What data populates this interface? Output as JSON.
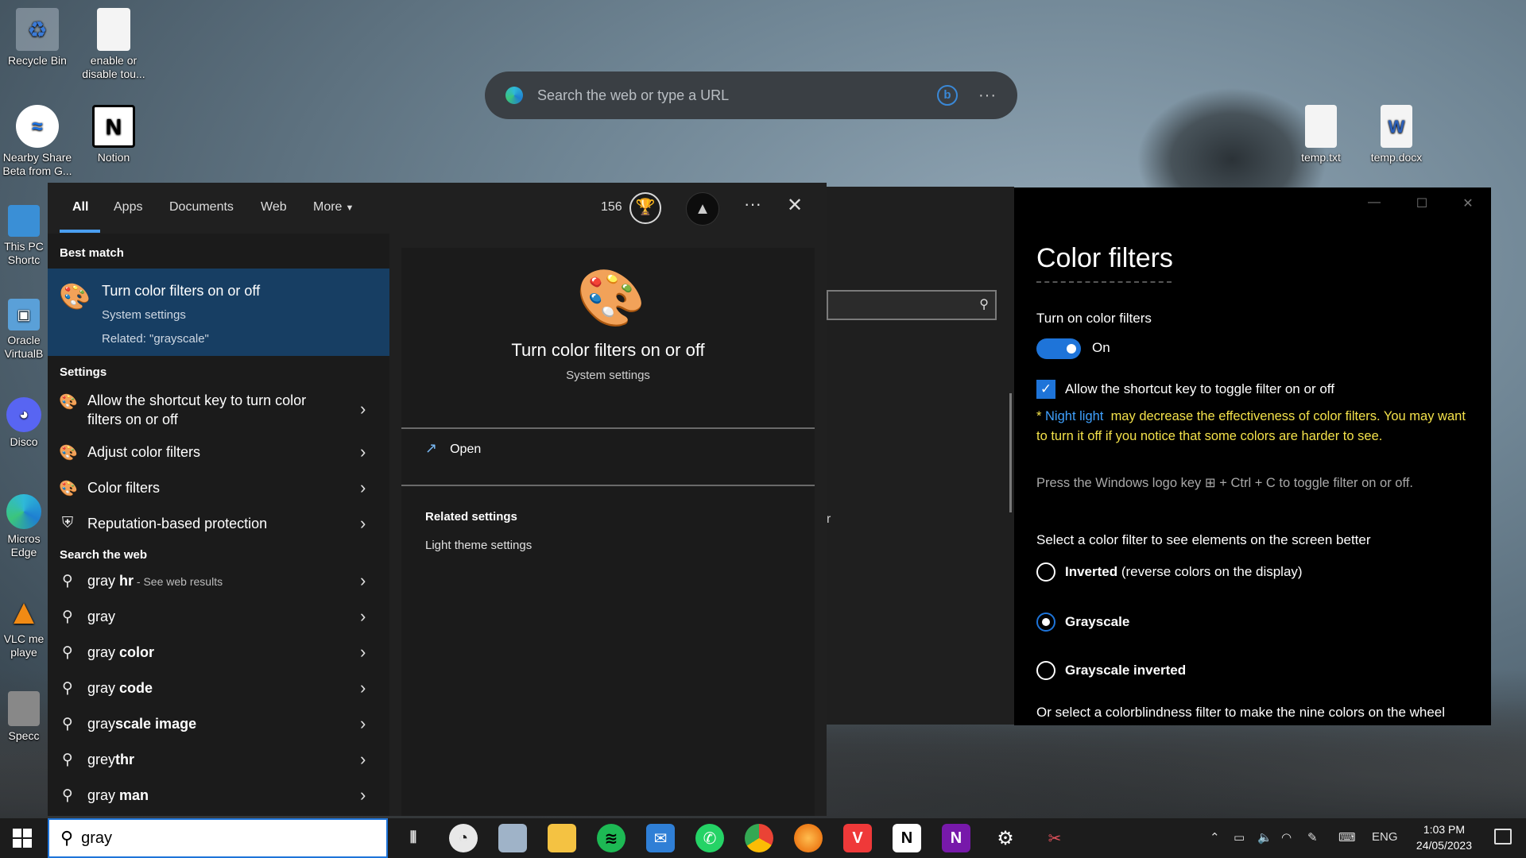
{
  "desktop": {
    "icons": [
      {
        "label": "Recycle Bin",
        "icon": "recycle-bin-icon"
      },
      {
        "label": "enable or disable tou...",
        "icon": "document-icon"
      },
      {
        "label": "Nearby Share Beta from G...",
        "icon": "nearby-share-icon"
      },
      {
        "label": "Notion",
        "icon": "notion-icon"
      },
      {
        "label": "This PC Shortc",
        "icon": "this-pc-icon"
      },
      {
        "label": "Oracle VirtualB",
        "icon": "virtualbox-icon"
      },
      {
        "label": "Disco",
        "icon": "discord-icon"
      },
      {
        "label": "Micros Edge",
        "icon": "edge-icon"
      },
      {
        "label": "VLC me playe",
        "icon": "vlc-icon"
      },
      {
        "label": "Specc",
        "icon": "speccy-icon"
      },
      {
        "label": "temp.txt",
        "icon": "text-file-icon"
      },
      {
        "label": "temp.docx",
        "icon": "word-file-icon"
      }
    ]
  },
  "edge_search": {
    "placeholder": "Search the web or type a URL",
    "bing_label": "b",
    "menu": "···"
  },
  "color_filters_window": {
    "title": "Color filters",
    "toggle_label": "Turn on color filters",
    "toggle_state": "On",
    "shortcut_checkbox_label": "Allow the shortcut key to toggle filter on or off",
    "warning_prefix": "* ",
    "warning_link": "Night light",
    "warning_text": "may decrease the effectiveness of color filters. You may want to turn it off if you notice that some colors are harder to see.",
    "shortcut_hint": "Press the Windows logo key ⊞ + Ctrl + C to toggle filter on or off.",
    "select_prompt": "Select a color filter to see elements on the screen better",
    "options": [
      {
        "name": "Inverted",
        "desc": " (reverse colors on the display)",
        "selected": false
      },
      {
        "name": "Grayscale",
        "desc": "",
        "selected": true
      },
      {
        "name": "Grayscale inverted",
        "desc": "",
        "selected": false
      }
    ],
    "colorblind_prompt": "Or select a colorblindness filter to make the nine colors on the wheel"
  },
  "background_settings": {
    "fragment": "r"
  },
  "search_panel": {
    "tabs": [
      "All",
      "Apps",
      "Documents",
      "Web",
      "More"
    ],
    "active_tab": "All",
    "points": "156",
    "best_match_header": "Best match",
    "best_match": {
      "title": "Turn color filters on or off",
      "subtitle": "System settings",
      "related": "Related: \"grayscale\""
    },
    "settings_header": "Settings",
    "settings": [
      "Allow the shortcut key to turn color filters on or off",
      "Adjust color filters",
      "Color filters",
      "Reputation-based protection"
    ],
    "web_header": "Search the web",
    "web_results": [
      {
        "prefix": "gray",
        "bold": " hr",
        "sub": " - See web results"
      },
      {
        "prefix": "gray",
        "bold": "",
        "sub": ""
      },
      {
        "prefix": "gray",
        "bold": " color",
        "sub": ""
      },
      {
        "prefix": "gray",
        "bold": " code",
        "sub": ""
      },
      {
        "prefix": "gray",
        "bold": "scale image",
        "sub": ""
      },
      {
        "prefix": "grey",
        "bold": "thr",
        "sub": ""
      },
      {
        "prefix": "gray",
        "bold": " man",
        "sub": ""
      }
    ],
    "preview": {
      "title": "Turn color filters on or off",
      "subtitle": "System settings",
      "open_label": "Open",
      "related_header": "Related settings",
      "related_link": "Light theme settings"
    },
    "query": "gray"
  },
  "taskbar": {
    "apps": [
      "task-view",
      "clock-app",
      "photos",
      "file-explorer",
      "spotify",
      "mail",
      "whatsapp",
      "chrome",
      "firefox",
      "vivaldi",
      "notion",
      "onenote",
      "settings",
      "snip-tool"
    ],
    "language": "ENG",
    "time": "1:03 PM",
    "date": "24/05/2023"
  }
}
